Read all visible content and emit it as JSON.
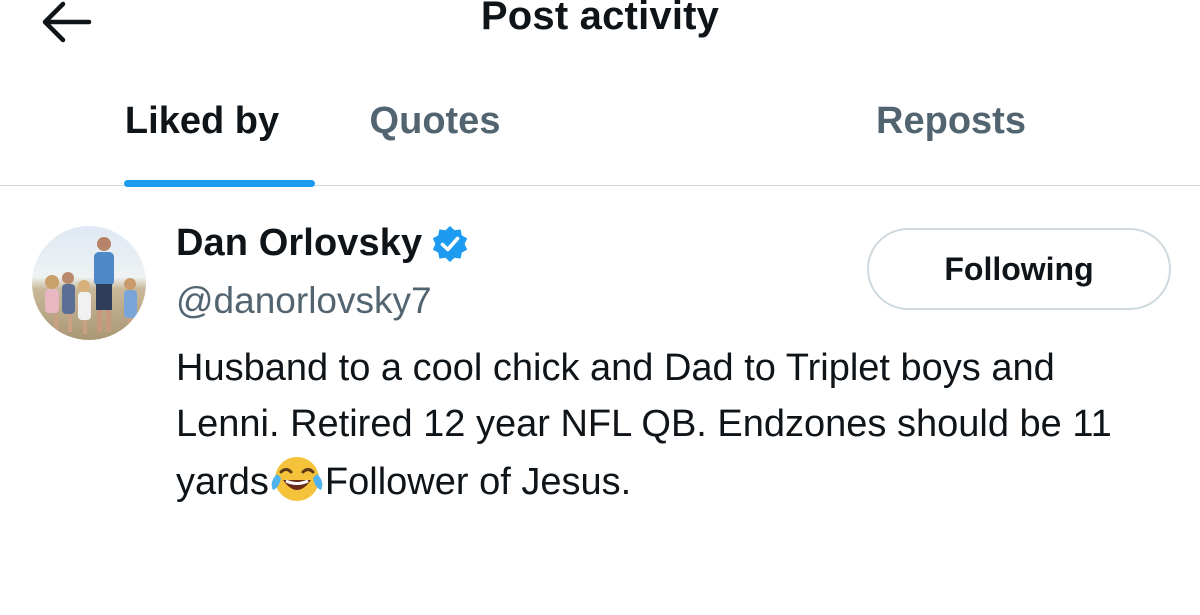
{
  "header": {
    "title": "Post activity",
    "back_icon": "arrow-left-icon"
  },
  "tabs": [
    {
      "label": "Liked by",
      "active": true
    },
    {
      "label": "Quotes",
      "active": false
    },
    {
      "label": "Reposts",
      "active": false
    }
  ],
  "users": [
    {
      "display_name": "Dan Orlovsky",
      "verified": true,
      "handle": "@danorlovsky7",
      "follow_label": "Following",
      "bio_part1": "Husband to a cool chick and Dad to Triplet boys and Lenni. Retired 12 year NFL QB. Endzones should be 11 yards",
      "bio_emoji": "face-with-tears-of-joy-icon",
      "bio_part2": "Follower of Jesus."
    }
  ],
  "colors": {
    "accent": "#1d9bf0",
    "text_primary": "#0f1419",
    "text_secondary": "#536471",
    "border": "#cfd9de"
  }
}
